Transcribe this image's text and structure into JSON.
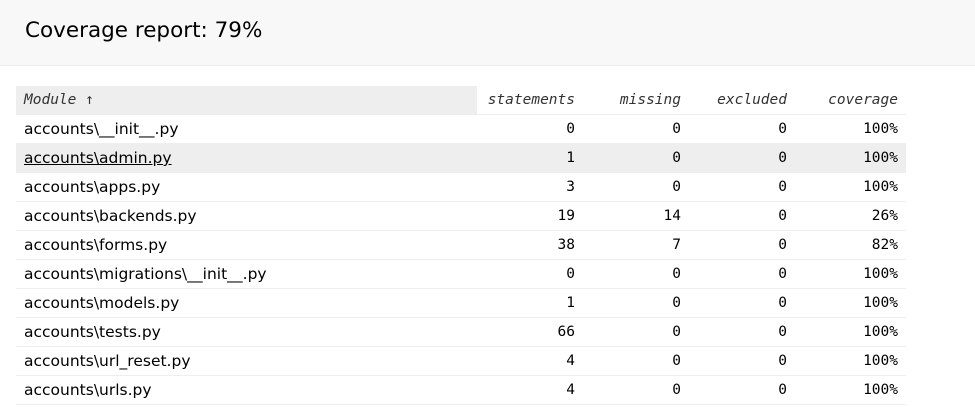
{
  "report": {
    "title": "Coverage report: 79%"
  },
  "table": {
    "headers": {
      "module": "Module ↑",
      "statements": "statements",
      "missing": "missing",
      "excluded": "excluded",
      "coverage": "coverage"
    },
    "rows": [
      {
        "name": "accounts\\__init__.py",
        "statements": "0",
        "missing": "0",
        "excluded": "0",
        "coverage": "100%"
      },
      {
        "name": "accounts\\admin.py",
        "statements": "1",
        "missing": "0",
        "excluded": "0",
        "coverage": "100%"
      },
      {
        "name": "accounts\\apps.py",
        "statements": "3",
        "missing": "0",
        "excluded": "0",
        "coverage": "100%"
      },
      {
        "name": "accounts\\backends.py",
        "statements": "19",
        "missing": "14",
        "excluded": "0",
        "coverage": "26%"
      },
      {
        "name": "accounts\\forms.py",
        "statements": "38",
        "missing": "7",
        "excluded": "0",
        "coverage": "82%"
      },
      {
        "name": "accounts\\migrations\\__init__.py",
        "statements": "0",
        "missing": "0",
        "excluded": "0",
        "coverage": "100%"
      },
      {
        "name": "accounts\\models.py",
        "statements": "1",
        "missing": "0",
        "excluded": "0",
        "coverage": "100%"
      },
      {
        "name": "accounts\\tests.py",
        "statements": "66",
        "missing": "0",
        "excluded": "0",
        "coverage": "100%"
      },
      {
        "name": "accounts\\url_reset.py",
        "statements": "4",
        "missing": "0",
        "excluded": "0",
        "coverage": "100%"
      },
      {
        "name": "accounts\\urls.py",
        "statements": "4",
        "missing": "0",
        "excluded": "0",
        "coverage": "100%"
      }
    ],
    "hovered_row_index": 1
  },
  "colors": {
    "header_background": "#f8f8f8",
    "row_highlight": "#eeeeee",
    "row_divider": "#eeeeee"
  }
}
